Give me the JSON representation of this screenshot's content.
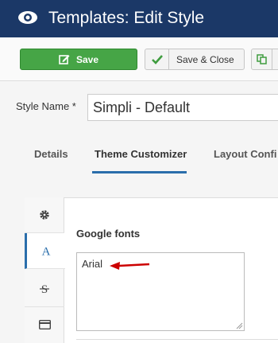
{
  "header": {
    "title": "Templates: Edit Style",
    "icon": "eye-icon"
  },
  "toolbar": {
    "save_label": "Save",
    "save_close_label": "Save & Close",
    "save_color": "#46a546"
  },
  "form": {
    "style_name_label": "Style Name *",
    "style_name_value": "Simpli - Default"
  },
  "tabs": [
    {
      "label": "Details",
      "active": false
    },
    {
      "label": "Theme Customizer",
      "active": true
    },
    {
      "label": "Layout Confi",
      "active": false
    }
  ],
  "customizer": {
    "sidebar_icons": [
      "gear-icon",
      "typography-icon",
      "strikethrough-icon",
      "credit-card-icon"
    ],
    "active_index": 1,
    "google_fonts_label": "Google fonts",
    "google_fonts_value": "Arial"
  },
  "colors": {
    "header_bg": "#1b3867",
    "accent": "#2a6eab",
    "annotation_arrow": "#cc0000"
  }
}
